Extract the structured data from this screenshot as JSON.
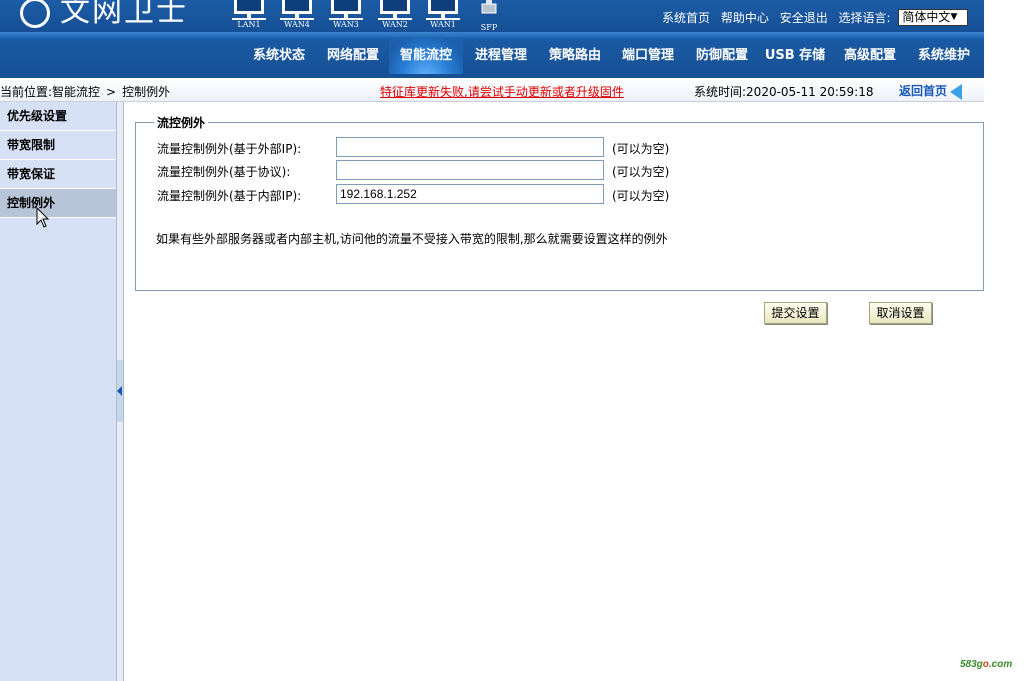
{
  "header": {
    "logo_text": "文网卫士",
    "ports": [
      "LAN1",
      "WAN4",
      "WAN3",
      "WAN2",
      "WAN1",
      "SFP"
    ],
    "top_links": [
      "系统首页",
      "帮助中心",
      "安全退出"
    ],
    "language_label": "选择语言:",
    "language_value": "简体中文",
    "nav": [
      "系统状态",
      "网络配置",
      "智能流控",
      "进程管理",
      "策略路由",
      "端口管理",
      "防御配置",
      "USB 存储",
      "高级配置",
      "系统维护"
    ],
    "active_nav": "智能流控"
  },
  "statusbar": {
    "breadcrumb_prefix": "当前位置:智能流控",
    "breadcrumb_sep": ">",
    "breadcrumb_current": "控制例外",
    "warning": "特征库更新失败,请尝试手动更新或者升级固件",
    "time_label": "系统时间:",
    "time_value": "2020-05-11 20:59:18",
    "return_home": "返回首页"
  },
  "sidebar": {
    "items": [
      "优先级设置",
      "带宽限制",
      "带宽保证",
      "控制例外"
    ],
    "active": "控制例外"
  },
  "panel": {
    "title": "流控例外",
    "rows": [
      {
        "label": "流量控制例外(基于外部IP):",
        "value": "",
        "hint": "(可以为空)"
      },
      {
        "label": "流量控制例外(基于协议):",
        "value": "",
        "hint": "(可以为空)"
      },
      {
        "label": "流量控制例外(基于内部IP):",
        "value": "192.168.1.252",
        "hint": "(可以为空)"
      }
    ],
    "description": "如果有些外部服务器或者内部主机,访问他的流量不受接入带宽的限制,那么就需要设置这样的例外"
  },
  "buttons": {
    "submit": "提交设置",
    "cancel": "取消设置"
  },
  "watermark": {
    "prefix": "583g",
    "o": "o",
    "suffix": ".com"
  },
  "colors": {
    "header_blue": "#14519d",
    "sidebar_bg": "#d6e1f5",
    "warning_red": "#e00000",
    "link_blue": "#1857b8"
  }
}
